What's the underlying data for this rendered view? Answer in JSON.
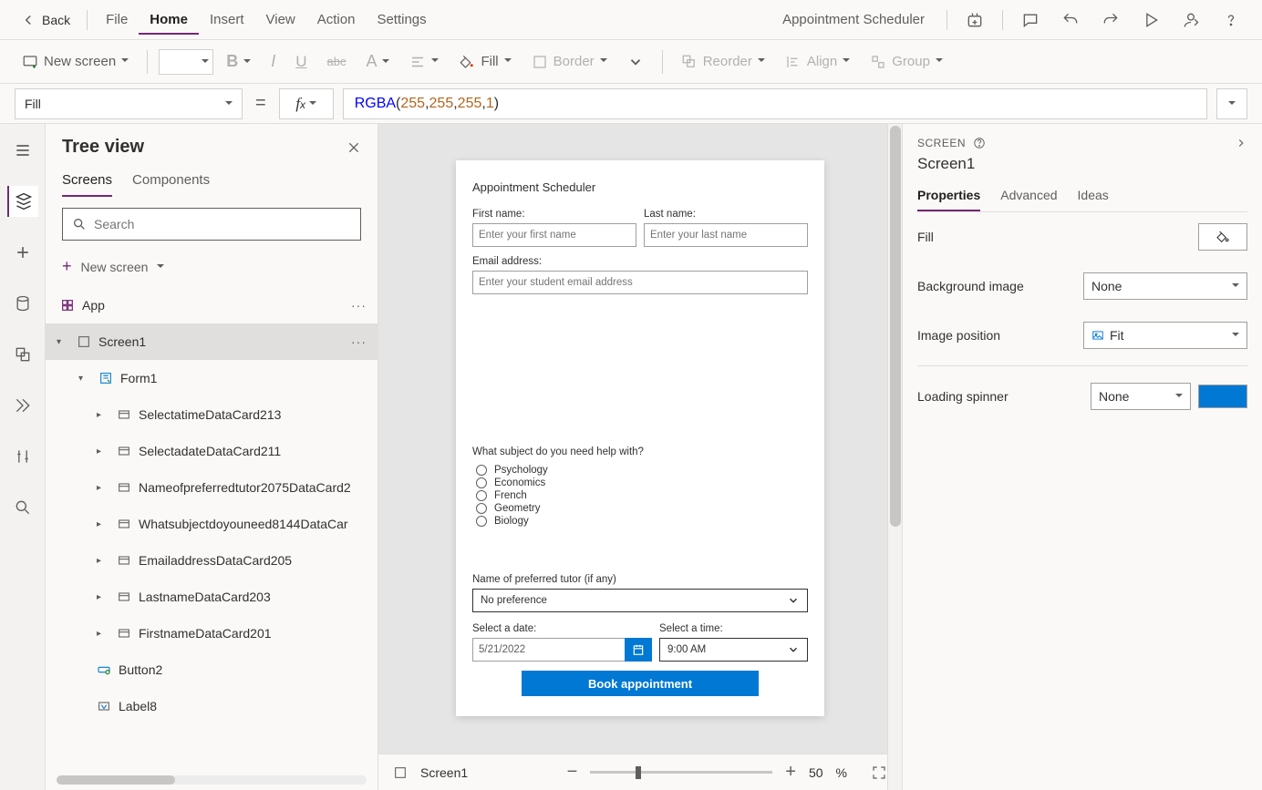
{
  "menubar": {
    "back": "Back",
    "items": [
      "File",
      "Home",
      "Insert",
      "View",
      "Action",
      "Settings"
    ],
    "activeIndex": 1,
    "appName": "Appointment Scheduler"
  },
  "ribbon": {
    "newScreen": "New screen",
    "fill": "Fill",
    "border": "Border",
    "reorder": "Reorder",
    "align": "Align",
    "group": "Group"
  },
  "formula": {
    "property": "Fill",
    "fn": "RGBA",
    "args": [
      "255",
      "255",
      "255",
      "1"
    ]
  },
  "treeview": {
    "title": "Tree view",
    "tabs": [
      "Screens",
      "Components"
    ],
    "searchPlaceholder": "Search",
    "newScreen": "New screen",
    "app": "App",
    "screen": "Screen1",
    "form": "Form1",
    "cards": [
      "SelectatimeDataCard213",
      "SelectadateDataCard211",
      "Nameofpreferredtutor2075DataCard2",
      "Whatsubjectdoyouneed8144DataCar",
      "EmailaddressDataCard205",
      "LastnameDataCard203",
      "FirstnameDataCard201"
    ],
    "button": "Button2",
    "label": "Label8"
  },
  "canvas": {
    "title": "Appointment Scheduler",
    "firstNameLabel": "First name:",
    "firstNamePh": "Enter your first name",
    "lastNameLabel": "Last name:",
    "lastNamePh": "Enter your last name",
    "emailLabel": "Email address:",
    "emailPh": "Enter your student email address",
    "subjectLabel": "What subject do you need help with?",
    "subjects": [
      "Psychology",
      "Economics",
      "French",
      "Geometry",
      "Biology"
    ],
    "tutorLabel": "Name of preferred tutor (if any)",
    "tutorValue": "No preference",
    "dateLabel": "Select a date:",
    "dateValue": "5/21/2022",
    "timeLabel": "Select a time:",
    "timeValue": "9:00 AM",
    "bookBtn": "Book appointment",
    "footerScreen": "Screen1",
    "zoom": "50",
    "zoomPct": "%"
  },
  "props": {
    "header": "SCREEN",
    "name": "Screen1",
    "tabs": [
      "Properties",
      "Advanced",
      "Ideas"
    ],
    "fillLabel": "Fill",
    "bgLabel": "Background image",
    "bgValue": "None",
    "imgPosLabel": "Image position",
    "imgPosValue": "Fit",
    "spinnerLabel": "Loading spinner",
    "spinnerValue": "None",
    "spinnerColor": "#0078d4"
  }
}
